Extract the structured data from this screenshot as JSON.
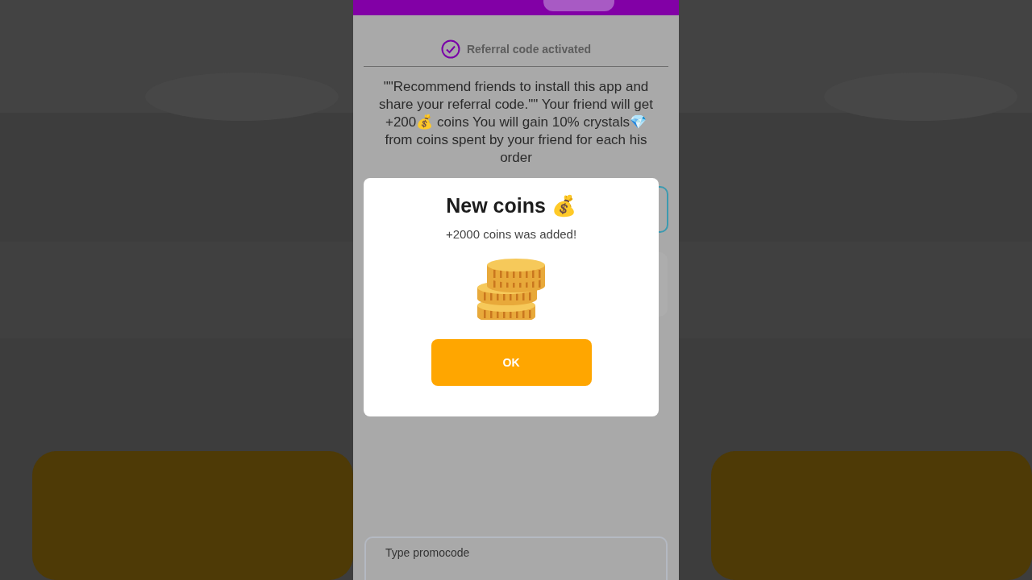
{
  "status": {
    "label": "Referral code activated",
    "checked": true
  },
  "description": "\"\"Recommend friends to install this app and share your referral code.\"\" Your friend will get +200💰 coins You will gain 10% crystals💎 from coins spent by your friend for each his order",
  "promo_field": {
    "placeholder": "Type promocode"
  },
  "dialog": {
    "title": "New coins 💰",
    "message": "+2000 coins was added!",
    "button": "OK"
  }
}
